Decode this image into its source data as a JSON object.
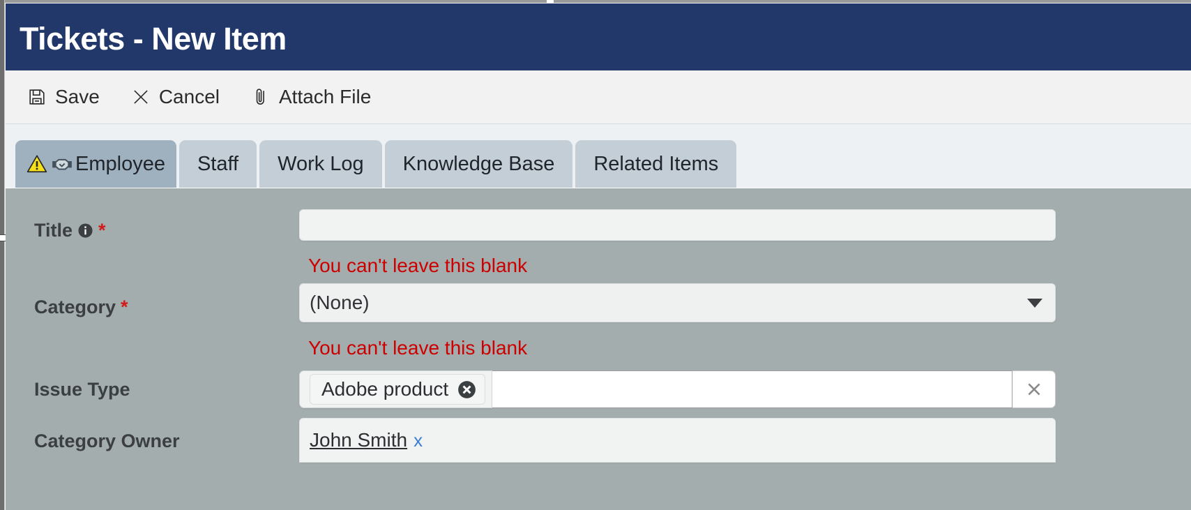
{
  "header": {
    "title": "Tickets - New Item",
    "bg_color": "#22386b"
  },
  "toolbar": {
    "items": [
      {
        "label": "Save",
        "icon": "floppy-disk-icon"
      },
      {
        "label": "Cancel",
        "icon": "x-close-icon"
      },
      {
        "label": "Attach File",
        "icon": "paperclip-icon"
      }
    ]
  },
  "tabs": [
    {
      "label": "Employee",
      "active": true,
      "icons": [
        "warning-triangle-icon",
        "handshake-icon"
      ]
    },
    {
      "label": "Staff",
      "active": false,
      "icons": []
    },
    {
      "label": "Work Log",
      "active": false,
      "icons": []
    },
    {
      "label": "Knowledge Base",
      "active": false,
      "icons": []
    },
    {
      "label": "Related Items",
      "active": false,
      "icons": []
    }
  ],
  "form": {
    "panel_bg": "#a4adad",
    "error_color": "#cc0000",
    "required_marker": "*",
    "title_field": {
      "label": "Title",
      "value": "",
      "placeholder": "",
      "required": true,
      "has_info_icon": true,
      "error": "You can't leave this blank"
    },
    "category_field": {
      "label": "Category",
      "value": "(None)",
      "required": true,
      "error": "You can't leave this blank"
    },
    "issue_type_field": {
      "label": "Issue Type",
      "token": "Adobe product",
      "input_value": "",
      "placeholder": "",
      "required": false
    },
    "category_owner_field": {
      "label": "Category Owner",
      "person": "John Smith",
      "remove_label": "x",
      "required": false
    }
  }
}
